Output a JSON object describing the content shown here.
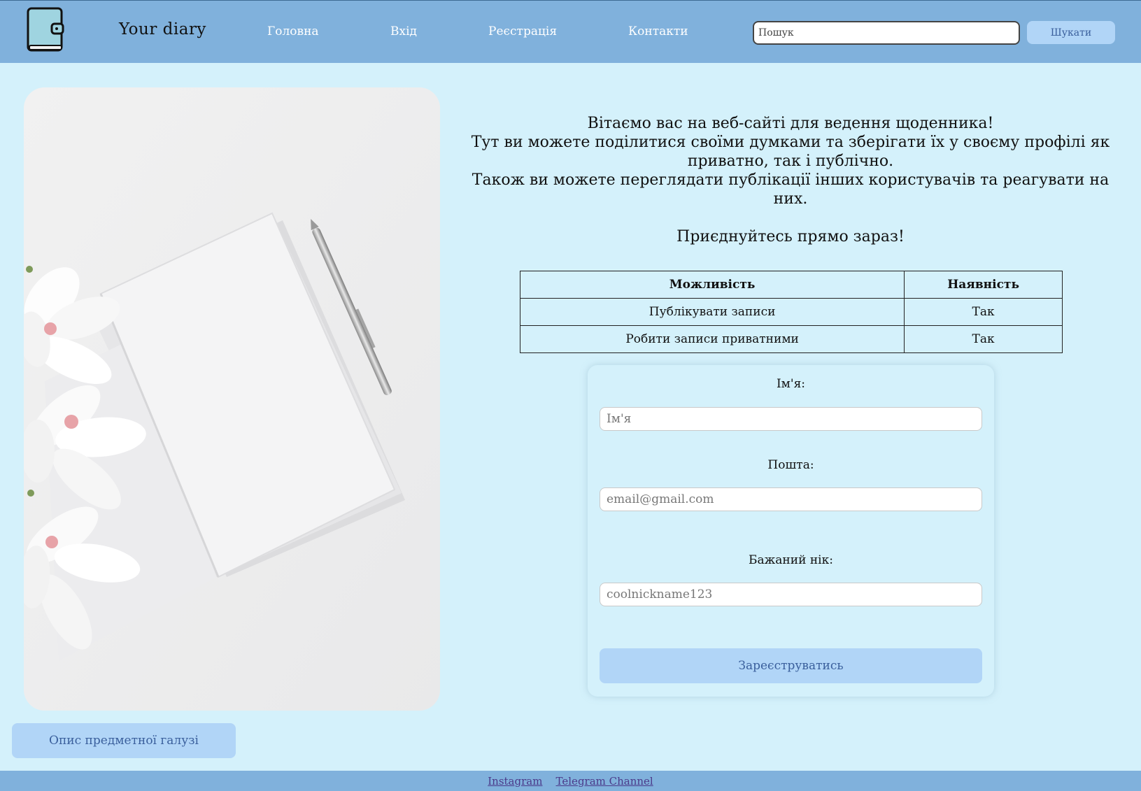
{
  "header": {
    "brand": "Your diary",
    "nav": [
      "Головна",
      "Вхід",
      "Реєстрація",
      "Контакти"
    ],
    "search": {
      "placeholder": "Пошук",
      "button": "Шукати"
    }
  },
  "hero": {
    "image_icon": "notebook-flowers-photo"
  },
  "intro": {
    "line1": "Вітаємо вас на веб-сайті для ведення щоденника!",
    "line2": "Тут ви можете поділитися своїми думками та зберігати їх у своєму профілі як приватно, так і публічно.",
    "line3": "Також ви можете переглядати публікації інших користувачів та реагувати на них.",
    "join": "Приєднуйтесь прямо зараз!"
  },
  "features_table": {
    "headers": [
      "Можливість",
      "Наявність"
    ],
    "rows": [
      [
        "Публікувати записи",
        "Так"
      ],
      [
        "Робити записи приватними",
        "Так"
      ]
    ]
  },
  "form": {
    "name_label": "Ім'я:",
    "name_placeholder": "Ім'я",
    "email_label": "Пошта:",
    "email_placeholder": "email@gmail.com",
    "nick_label": "Бажаний нік:",
    "nick_placeholder": "coolnickname123",
    "submit": "Зареєструватись"
  },
  "description_button": "Опис предметної галузі",
  "footer": {
    "links": [
      "Instagram",
      "Telegram Channel"
    ]
  },
  "colors": {
    "background": "#d4f1fb",
    "header": "#80b1dc",
    "button": "#b1d5f7",
    "button_text": "#3a5f9c"
  }
}
